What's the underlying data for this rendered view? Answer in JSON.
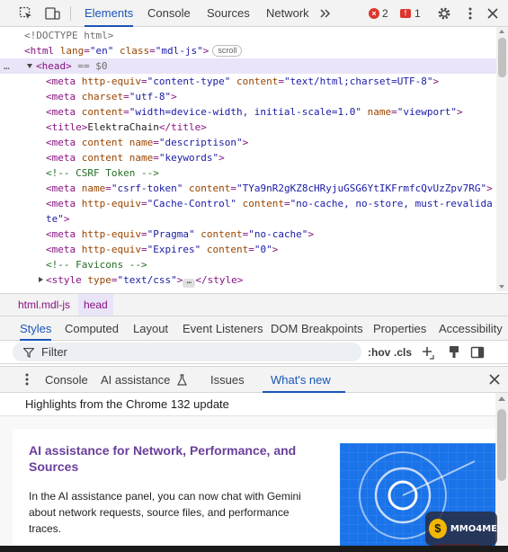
{
  "toolbar": {
    "tabs": [
      "Elements",
      "Console",
      "Sources",
      "Network"
    ],
    "active_tab": "Elements",
    "errors_count": "2",
    "issues_count": "1"
  },
  "tree": {
    "l1_doctype": "<!DOCTYPE html>",
    "l2_open": "<",
    "l2_tag": "html",
    "l2_attr1": "lang",
    "l2_val1": "\"en\"",
    "l2_attr2": "class",
    "l2_val2": "\"mdl-js\"",
    "l2_close": ">",
    "scroll_badge": "scroll",
    "l3_prefix": "…",
    "l3_tag": "<head>",
    "l3_eq": " == $0",
    "meta_tag": "<meta",
    "close_gt": ">",
    "m1_a1": "http-equiv",
    "m1_v1": "\"content-type\"",
    "m1_a2": "content",
    "m1_v2": "\"text/html;charset=UTF-8\"",
    "m2_a1": "charset",
    "m2_v1": "\"utf-8\"",
    "m3_a1": "content",
    "m3_v1": "\"width=device-width, initial-scale=1.0\"",
    "m3_a2": "name",
    "m3_v2": "\"viewport\"",
    "title_open": "<title>",
    "title_text": "ElektraChain",
    "title_close": "</title>",
    "m4_a1": "content",
    "m4_a2": "name",
    "m4_v2": "\"descriptison\"",
    "m5_a1": "content",
    "m5_a2": "name",
    "m5_v2": "\"keywords\"",
    "comment1": "<!-- CSRF Token -->",
    "m6_a1": "name",
    "m6_v1": "\"csrf-token\"",
    "m6_a2": "content",
    "m6_v2": "\"TYa9nR2gKZ8cHRyjuGSG6YtIKFrmfcQvUzZpv7RG\"",
    "m7_a1": "http-equiv",
    "m7_v1": "\"Cache-Control\"",
    "m7_a2": "content",
    "m7_v2a": "\"no-cache, no-store, must-revalida",
    "m7_v2b": "te\"",
    "m8_a1": "http-equiv",
    "m8_v1": "\"Pragma\"",
    "m8_a2": "content",
    "m8_v2": "\"no-cache\"",
    "m9_a1": "http-equiv",
    "m9_v1": "\"Expires\"",
    "m9_a2": "content",
    "m9_v2": "\"0\"",
    "comment2": "<!-- Favicons -->",
    "style_open": "<style",
    "style_attr": "type",
    "style_val": "\"text/css\"",
    "style_gt": ">",
    "ellipsis": "…",
    "style_close": "</style>"
  },
  "breadcrumbs": [
    "html.mdl-js",
    "head"
  ],
  "subtabs": [
    "Styles",
    "Computed",
    "Layout",
    "Event Listeners",
    "DOM Breakpoints",
    "Properties",
    "Accessibility"
  ],
  "filter": {
    "placeholder": "Filter",
    "hov": ":hov",
    "cls": ".cls"
  },
  "drawer": {
    "tabs": [
      "Console",
      "AI assistance",
      "Issues",
      "What's new"
    ],
    "active_tab": "What's new"
  },
  "whats_new": {
    "header": "Highlights from the Chrome 132 update",
    "card_title": "AI assistance for Network, Performance, and Sources",
    "card_text": "In the AI assistance panel, you can now chat with Gemini about network requests, source files, and performance traces."
  },
  "watermark": {
    "logo_letter": "$",
    "text": "MMO4ME"
  },
  "colors": {
    "accent": "#1a55b8",
    "tag": "#881280",
    "attr": "#994500",
    "value": "#1a1aa6",
    "card_title": "#6a3f9c",
    "selected_row": "#e9e4f7"
  }
}
